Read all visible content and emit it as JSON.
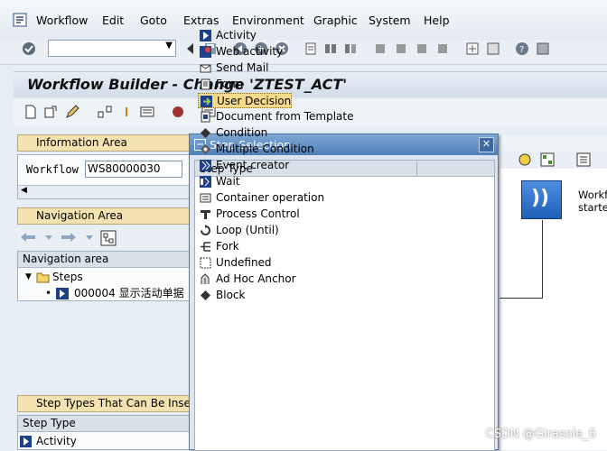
{
  "menu": [
    "Workflow",
    "Edit",
    "Goto",
    "Extras",
    "Environment",
    "Graphic",
    "System",
    "Help"
  ],
  "title": "Workflow Builder - Change 'ZTEST_ACT'",
  "info_area": {
    "header": "Information Area",
    "label": "Workflow",
    "value": "WS80000030"
  },
  "nav_area": {
    "header": "Navigation Area",
    "col_header": "Navigation area",
    "root": "Steps",
    "item": "000004 显示活动单据"
  },
  "step_types_area": {
    "header": "Step Types That Can Be Inserted",
    "col_header": "Step Type",
    "first": "Activity"
  },
  "dialog": {
    "title": "Step Selection",
    "col_header": "Step Type",
    "selected_index": 4,
    "items": [
      "Activity",
      "Web activity",
      "Send Mail",
      "Form",
      "User Decision",
      "Document from Template",
      "Condition",
      "Multiple Condition",
      "Event creator",
      "Wait",
      "Container operation",
      "Process Control",
      "Loop (Until)",
      "Fork",
      "Undefined",
      "Ad Hoc Anchor",
      "Block"
    ]
  },
  "canvas": {
    "text1": "Workf",
    "text2": "starte"
  },
  "watermark": "CSDN @Girasole_6",
  "colors": {
    "accent": "#4f7fb8",
    "selection": "#f7d98a",
    "header_yellow": "#f4e2b0"
  }
}
